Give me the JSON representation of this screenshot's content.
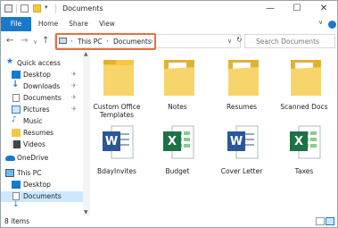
{
  "window": {
    "title": "Documents",
    "controls": {
      "minimize": "—",
      "maximize": "☐",
      "close": "✕"
    }
  },
  "ribbon": {
    "tabs": [
      "File",
      "Home",
      "Share",
      "View"
    ],
    "expand_glyph": "∨"
  },
  "address": {
    "back": "←",
    "forward": "→",
    "recent": "∨",
    "up": "↑",
    "breadcrumbs": [
      "This PC",
      "Documents"
    ],
    "sep": "›",
    "dropdown": "∨",
    "refresh": "↻",
    "search_placeholder": "Search Documents"
  },
  "nav": {
    "items": [
      {
        "label": "Quick access",
        "icon": "star-icon",
        "pinned": false
      },
      {
        "label": "Desktop",
        "icon": "desktop-icon",
        "pinned": true
      },
      {
        "label": "Downloads",
        "icon": "download-icon",
        "pinned": true
      },
      {
        "label": "Documents",
        "icon": "document-icon",
        "pinned": true
      },
      {
        "label": "Pictures",
        "icon": "pictures-icon",
        "pinned": true
      },
      {
        "label": "Music",
        "icon": "music-icon",
        "pinned": false
      },
      {
        "label": "Resumes",
        "icon": "folder-icon",
        "pinned": false
      },
      {
        "label": "Videos",
        "icon": "video-icon",
        "pinned": false
      },
      {
        "label": "OneDrive",
        "icon": "cloud-icon",
        "pinned": false
      },
      {
        "label": "This PC",
        "icon": "pc-icon",
        "pinned": false
      },
      {
        "label": "Desktop",
        "icon": "desktop-icon",
        "pinned": false
      },
      {
        "label": "Documents",
        "icon": "document-icon",
        "pinned": false
      }
    ],
    "pin_glyph": "✈"
  },
  "files": [
    {
      "name": "Custom Office Templates",
      "type": "folder"
    },
    {
      "name": "Notes",
      "type": "folder"
    },
    {
      "name": "Resumes",
      "type": "folder"
    },
    {
      "name": "Scanned Docs",
      "type": "folder"
    },
    {
      "name": "BdayInvites",
      "type": "word",
      "letter": "W"
    },
    {
      "name": "Budget",
      "type": "excel",
      "letter": "X"
    },
    {
      "name": "Cover Letter",
      "type": "word",
      "letter": "W"
    },
    {
      "name": "Taxes",
      "type": "excel",
      "letter": "X"
    }
  ],
  "status": {
    "items": "8 items"
  },
  "colors": {
    "accent": "#1979ca",
    "highlight": "#e8703f",
    "folder": "#f5c842",
    "word": "#2b5797",
    "excel": "#1e7145",
    "selected": "#cce8ff"
  }
}
